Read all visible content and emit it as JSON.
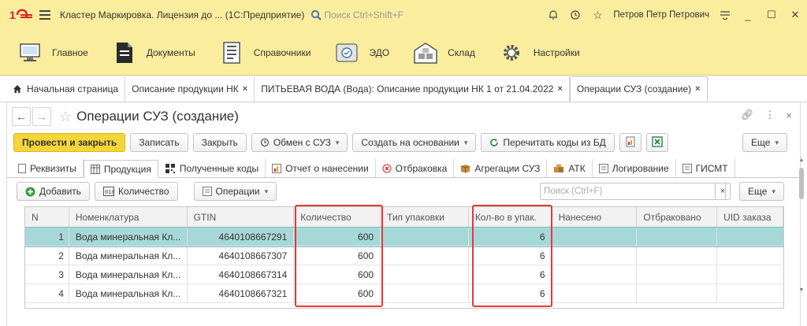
{
  "titlebar": {
    "app_title": "Кластер Маркировка. Лицензия до ...  (1С:Предприятие)",
    "search_placeholder": "Поиск Ctrl+Shift+F",
    "user_name": "Петров Петр Петрович"
  },
  "sections": [
    {
      "label": "Главное",
      "icon": "monitor-icon"
    },
    {
      "label": "Документы",
      "icon": "document-icon"
    },
    {
      "label": "Справочники",
      "icon": "catalog-icon"
    },
    {
      "label": "ЭДО",
      "icon": "edo-icon"
    },
    {
      "label": "Склад",
      "icon": "warehouse-icon"
    },
    {
      "label": "Настройки",
      "icon": "gear-icon"
    }
  ],
  "open_tabs": [
    {
      "label": "Начальная страница"
    },
    {
      "label": "Описание продукции НК"
    },
    {
      "label": "ПИТЬЕВАЯ ВОДА (Вода): Описание продукции НК 1 от 21.04.2022"
    },
    {
      "label": "Операции СУЗ (создание)"
    }
  ],
  "form": {
    "title": "Операции СУЗ (создание)",
    "commands": {
      "post_close": "Провести и закрыть",
      "save": "Записать",
      "close": "Закрыть",
      "exchange": "Обмен с СУЗ",
      "create_based": "Создать на основании",
      "reread": "Перечитать коды из БД",
      "more": "Еще"
    },
    "tabs": [
      {
        "label": "Реквизиты"
      },
      {
        "label": "Продукция"
      },
      {
        "label": "Полученные коды"
      },
      {
        "label": "Отчет о нанесении"
      },
      {
        "label": "Отбраковка"
      },
      {
        "label": "Агрегации СУЗ"
      },
      {
        "label": "АТК"
      },
      {
        "label": "Логирование"
      },
      {
        "label": "ГИСМТ"
      }
    ],
    "table_toolbar": {
      "add": "Добавить",
      "quantity": "Количество",
      "operations": "Операции",
      "search_placeholder": "Поиск (Ctrl+F)",
      "clear": "×",
      "more": "Еще"
    },
    "columns": [
      "N",
      "Номенклатура",
      "GTIN",
      "Количество",
      "Тип упаковки",
      "Кол-во в упак.",
      "Нанесено",
      "Отбраковано",
      "UID заказа"
    ],
    "rows": [
      {
        "n": "1",
        "name": "Вода минеральная Кл...",
        "gtin": "4640108667291",
        "qty": "600",
        "pack_type": "",
        "per_pack": "6",
        "applied": "",
        "rejected": "",
        "uid": ""
      },
      {
        "n": "2",
        "name": "Вода минеральная Кл...",
        "gtin": "4640108667307",
        "qty": "600",
        "pack_type": "",
        "per_pack": "6",
        "applied": "",
        "rejected": "",
        "uid": ""
      },
      {
        "n": "3",
        "name": "Вода минеральная Кл...",
        "gtin": "4640108667314",
        "qty": "600",
        "pack_type": "",
        "per_pack": "6",
        "applied": "",
        "rejected": "",
        "uid": ""
      },
      {
        "n": "4",
        "name": "Вода минеральная Кл...",
        "gtin": "4640108667321",
        "qty": "600",
        "pack_type": "",
        "per_pack": "6",
        "applied": "",
        "rejected": "",
        "uid": ""
      }
    ]
  },
  "colors": {
    "accent_yellow": "#fbed9e",
    "primary_button": "#f5d53a",
    "selected_row": "#a7d8d8",
    "highlight_red": "#e53935"
  }
}
